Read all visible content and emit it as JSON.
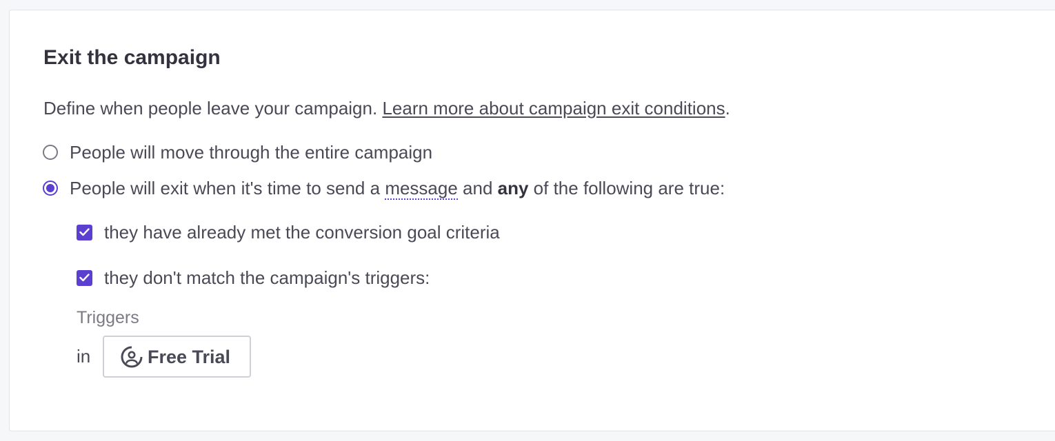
{
  "panel": {
    "title": "Exit the campaign",
    "description": "Define when people leave your campaign. ",
    "learn_more_link": "Learn more about campaign exit conditions",
    "description_end": "."
  },
  "options": {
    "entire_campaign": {
      "label": "People will move through the entire campaign",
      "selected": false
    },
    "exit_when": {
      "label_pre": "People will exit when it's time to send a ",
      "label_message": "message",
      "label_mid": " and ",
      "label_bold": "any",
      "label_post": " of the following are true:",
      "selected": true
    }
  },
  "conditions": {
    "conversion_goal": {
      "label": "they have already met the conversion goal criteria",
      "checked": true
    },
    "triggers_mismatch": {
      "label": "they don't match the campaign's triggers:",
      "checked": true
    }
  },
  "triggers": {
    "heading": "Triggers",
    "in_label": "in",
    "segment": {
      "name": "Free Trial",
      "icon": "segment-icon"
    }
  },
  "colors": {
    "accent": "#5b3fd1",
    "text": "#4a4a57",
    "title": "#33323e",
    "muted": "#7b7b86",
    "border": "#cfd0d6"
  }
}
